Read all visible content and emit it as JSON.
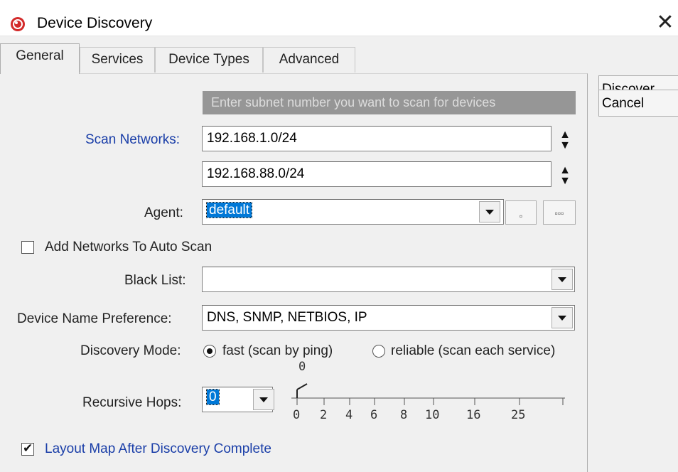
{
  "window": {
    "title": "Device Discovery",
    "close_glyph": "✕",
    "icon": "app-logo-icon"
  },
  "tabs": [
    {
      "label": "General",
      "active": true
    },
    {
      "label": "Services",
      "active": false
    },
    {
      "label": "Device Types",
      "active": false
    },
    {
      "label": "Advanced",
      "active": false
    }
  ],
  "actions": {
    "discover": "Discover",
    "cancel": "Cancel"
  },
  "general": {
    "hint": "Enter subnet number you want to scan for devices",
    "scan_networks_label": "Scan Networks:",
    "networks": [
      "192.168.1.0/24",
      "192.168.88.0/24"
    ],
    "agent_label": "Agent:",
    "agent_value": "default",
    "agent_btn1": "▫",
    "agent_btn2": "▫▫▫",
    "add_networks_label": "Add Networks To Auto Scan",
    "add_networks_checked": false,
    "black_list_label": "Black List:",
    "black_list_value": "",
    "name_pref_label": "Device Name Preference:",
    "name_pref_value": "DNS, SNMP, NETBIOS, IP",
    "mode_label": "Discovery Mode:",
    "mode_fast": "fast (scan by ping)",
    "mode_reliable": "reliable (scan each service)",
    "mode_selected": "fast",
    "hops_label": "Recursive Hops:",
    "hops_value": "0",
    "slider_value_label": "0",
    "slider_ticks": [
      "0",
      "2",
      "4",
      "6",
      "8",
      "10",
      "16",
      "25"
    ],
    "layout_label": "Layout Map After Discovery Complete",
    "layout_checked": true
  },
  "colors": {
    "label_blue": "#1a3ea8",
    "selection": "#0078d7",
    "hint_bg": "#969696"
  }
}
